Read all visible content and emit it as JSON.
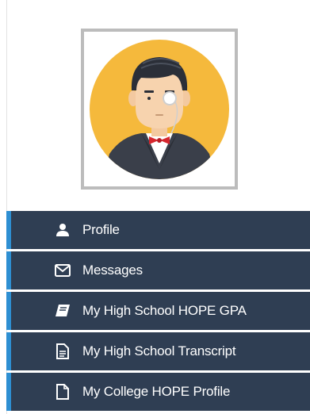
{
  "avatar": {
    "alt": "user-avatar",
    "bg_color": "#f5b93c"
  },
  "menu": {
    "accent_color": "#2e8fd2",
    "bg_color": "#2f3e53",
    "items": [
      {
        "label": "Profile",
        "icon": "user-icon"
      },
      {
        "label": "Messages",
        "icon": "envelope-icon"
      },
      {
        "label": "My High School HOPE GPA",
        "icon": "book-icon"
      },
      {
        "label": "My High School Transcript",
        "icon": "document-text-icon"
      },
      {
        "label": "My College HOPE Profile",
        "icon": "document-icon"
      }
    ]
  }
}
